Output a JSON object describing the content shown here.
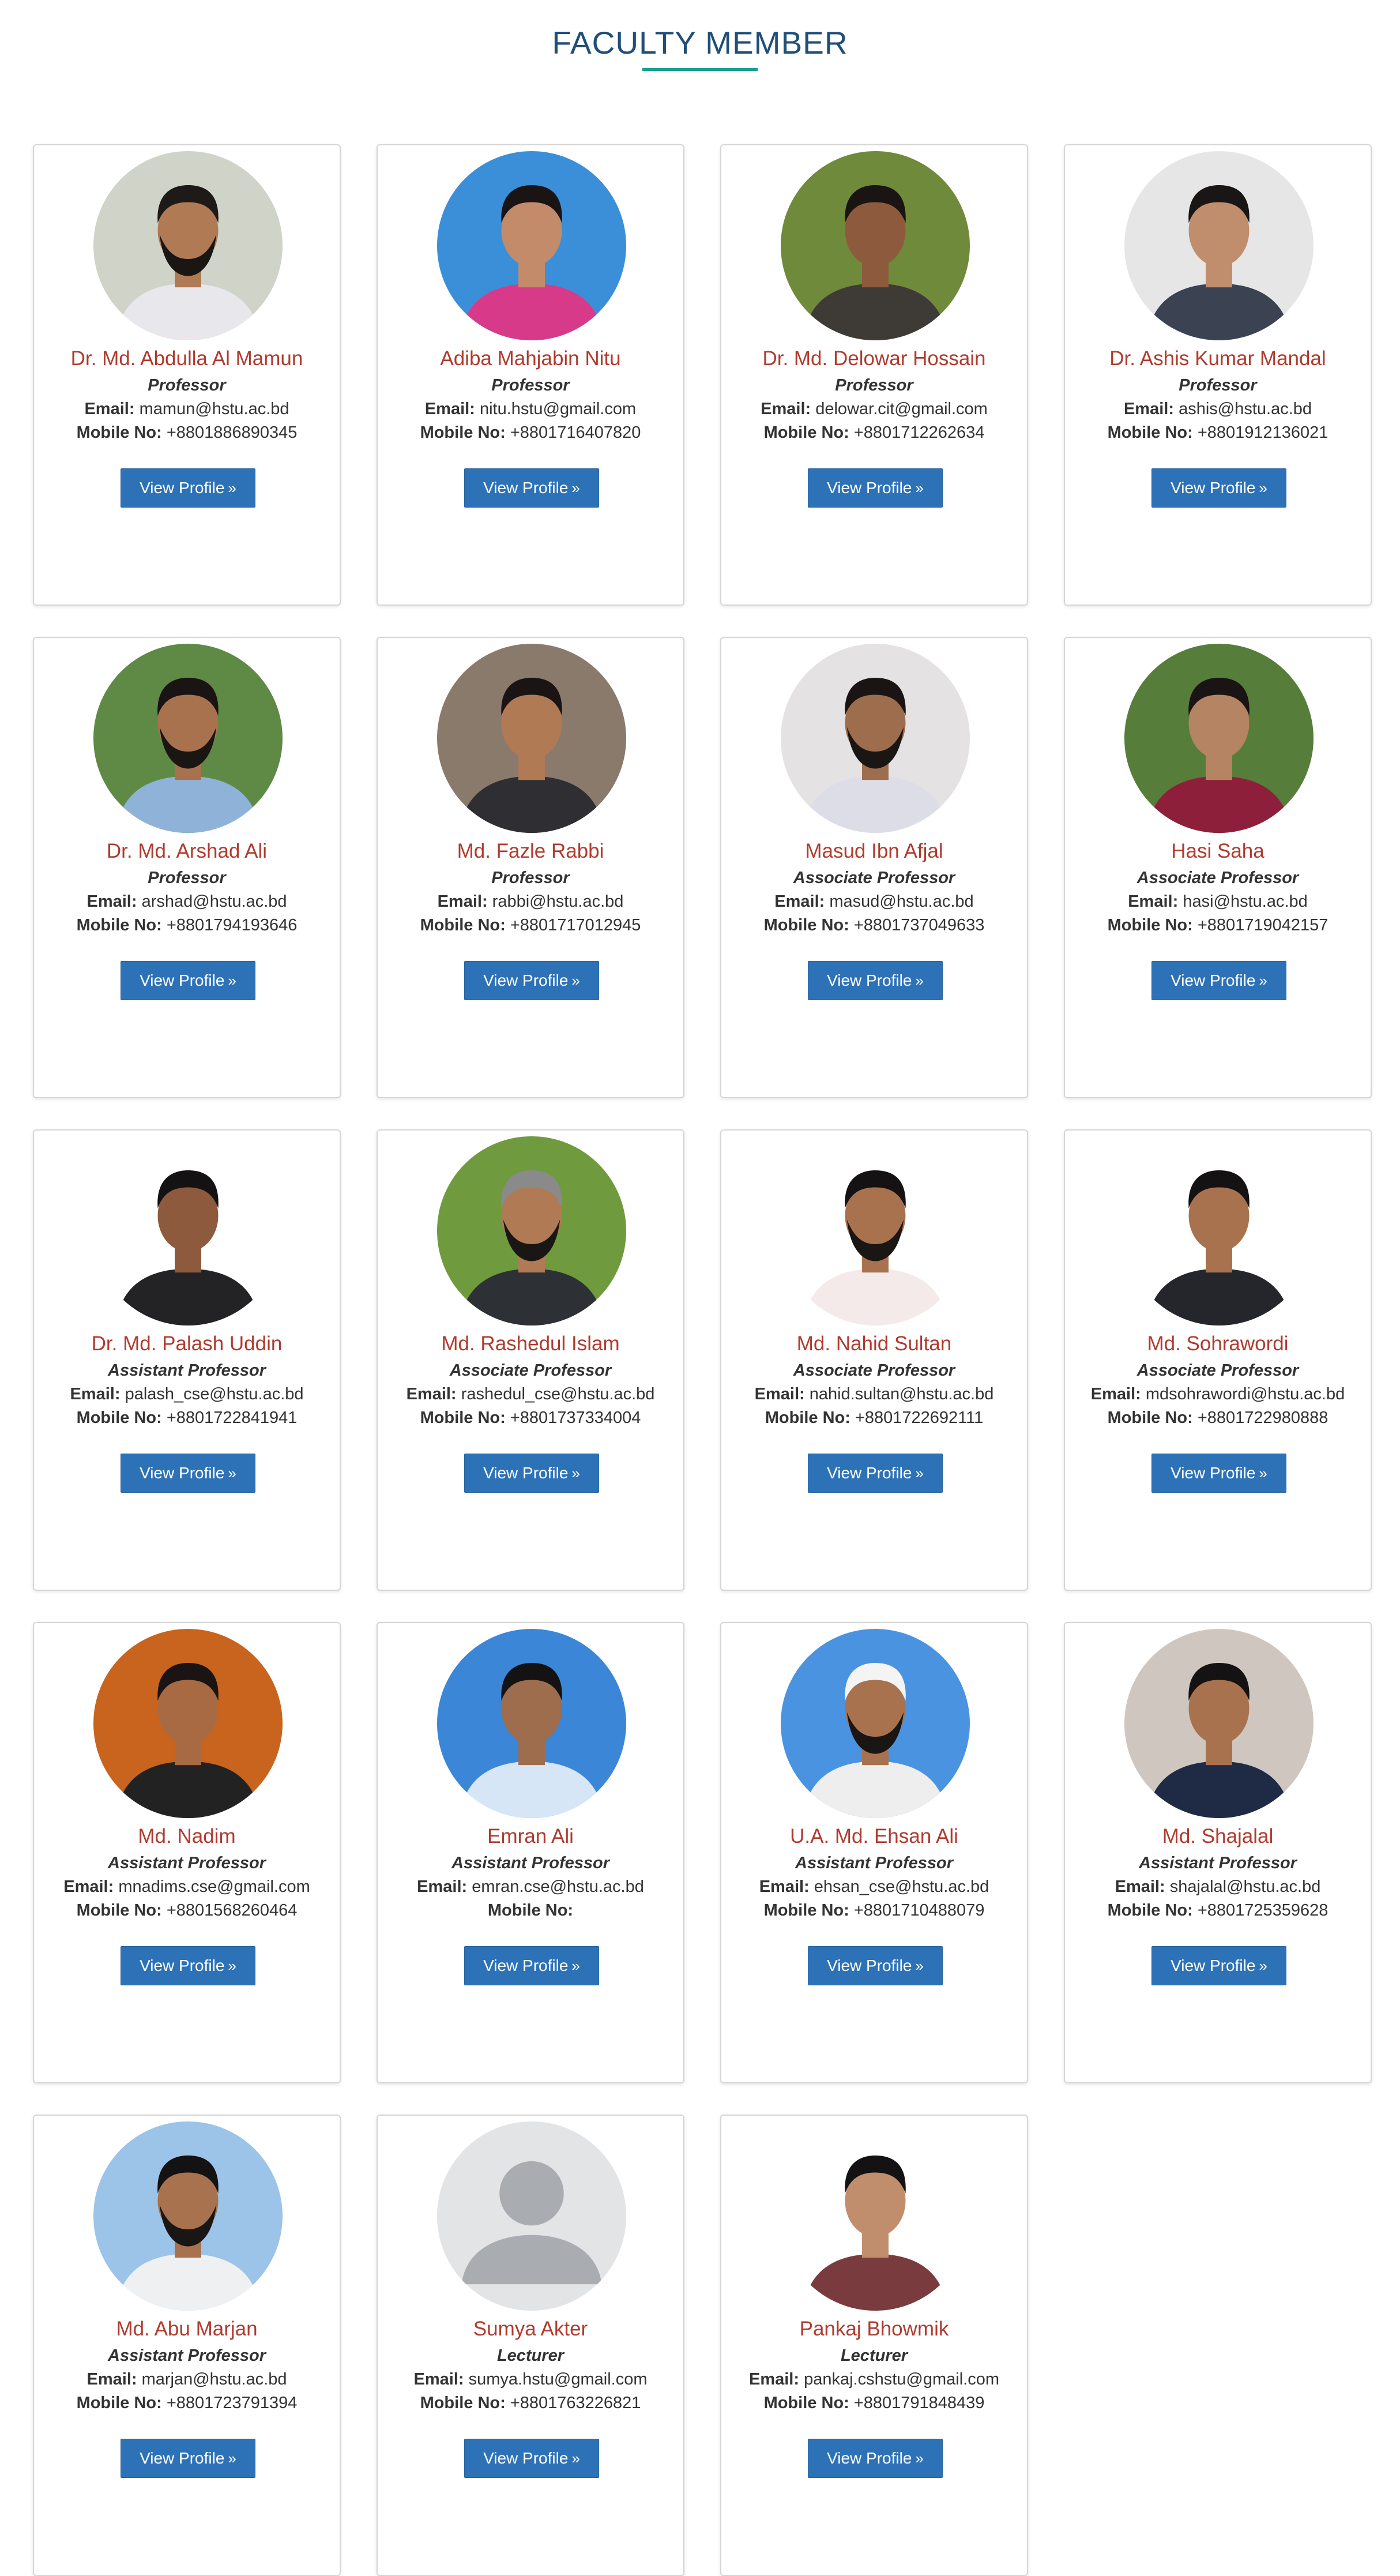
{
  "page": {
    "title": "FACULTY MEMBER"
  },
  "labels": {
    "email": "Email:",
    "mobile": "Mobile No:",
    "button": "View Profile",
    "button_icon": "»"
  },
  "members": [
    {
      "name": "Dr. Md. Abdulla Al Mamun",
      "designation": "Professor",
      "email": "mamun@hstu.ac.bd",
      "mobile": "+8801886890345",
      "photo": {
        "bg": "#cfd3c8",
        "skin": "#b07a55",
        "shirt": "#e8e8ec",
        "hair": "#1e1a18",
        "beard": true
      }
    },
    {
      "name": "Adiba Mahjabin Nitu",
      "designation": "Professor",
      "email": "nitu.hstu@gmail.com",
      "mobile": "+8801716407820",
      "photo": {
        "bg": "#3b8fd9",
        "skin": "#c48b6a",
        "shirt": "#d83a8a",
        "hair": "#1a1414",
        "beard": false
      }
    },
    {
      "name": "Dr. Md. Delowar Hossain",
      "designation": "Professor",
      "email": "delowar.cit@gmail.com",
      "mobile": "+8801712262634",
      "photo": {
        "bg": "#6f8a3a",
        "skin": "#8d5a3d",
        "shirt": "#3e3b36",
        "hair": "#1a1512",
        "beard": false
      }
    },
    {
      "name": "Dr. Ashis Kumar Mandal",
      "designation": "Professor",
      "email": "ashis@hstu.ac.bd",
      "mobile": "+8801912136021",
      "photo": {
        "bg": "#e6e6e6",
        "skin": "#c08e6c",
        "shirt": "#3b4252",
        "hair": "#1a1616",
        "beard": false
      }
    },
    {
      "name": "Dr. Md. Arshad Ali",
      "designation": "Professor",
      "email": "arshad@hstu.ac.bd",
      "mobile": "+8801794193646",
      "photo": {
        "bg": "#5f8a45",
        "skin": "#a8724f",
        "shirt": "#8fb3d8",
        "hair": "#1a1514",
        "beard": true
      }
    },
    {
      "name": "Md. Fazle Rabbi",
      "designation": "Professor",
      "email": "rabbi@hstu.ac.bd",
      "mobile": "+8801717012945",
      "photo": {
        "bg": "#8a7a6c",
        "skin": "#b07a55",
        "shirt": "#2f2f33",
        "hair": "#1a1514",
        "beard": false
      }
    },
    {
      "name": "Masud Ibn Afjal",
      "designation": "Associate Professor",
      "email": "masud@hstu.ac.bd",
      "mobile": "+8801737049633",
      "photo": {
        "bg": "#e4e2e2",
        "skin": "#9e6d4d",
        "shirt": "#dcdde6",
        "hair": "#1a1514",
        "beard": true
      }
    },
    {
      "name": "Hasi Saha",
      "designation": "Associate Professor",
      "email": "hasi@hstu.ac.bd",
      "mobile": "+8801719042157",
      "photo": {
        "bg": "#567d3a",
        "skin": "#b58462",
        "shirt": "#8e1f3a",
        "hair": "#1a1414",
        "beard": false
      }
    },
    {
      "name": "Dr. Md. Palash Uddin",
      "designation": "Assistant Professor",
      "email": "palash_cse@hstu.ac.bd",
      "mobile": "+8801722841941",
      "photo": {
        "bg": "#ffffff",
        "skin": "#8d5a3d",
        "shirt": "#232326",
        "hair": "#141212",
        "beard": false
      }
    },
    {
      "name": "Md. Rashedul Islam",
      "designation": "Associate Professor",
      "email": "rashedul_cse@hstu.ac.bd",
      "mobile": "+8801737334004",
      "photo": {
        "bg": "#6f9a3e",
        "skin": "#b07a55",
        "shirt": "#2d3136",
        "hair": "#8a8a8a",
        "beard": true
      }
    },
    {
      "name": "Md. Nahid Sultan",
      "designation": "Associate Professor",
      "email": "nahid.sultan@hstu.ac.bd",
      "mobile": "+8801722692111",
      "photo": {
        "bg": "#ffffff",
        "skin": "#a8724f",
        "shirt": "#f4eaea",
        "hair": "#141212",
        "beard": true
      }
    },
    {
      "name": "Md. Sohrawordi",
      "designation": "Associate Professor",
      "email": "mdsohrawordi@hstu.ac.bd",
      "mobile": "+8801722980888",
      "photo": {
        "bg": "#ffffff",
        "skin": "#a8724f",
        "shirt": "#25262b",
        "hair": "#141212",
        "beard": false
      }
    },
    {
      "name": "Md. Nadim",
      "designation": "Assistant Professor",
      "email": "mnadims.cse@gmail.com",
      "mobile": "+8801568260464",
      "photo": {
        "bg": "#c8641e",
        "skin": "#a86a42",
        "shirt": "#222222",
        "hair": "#1a1514",
        "beard": false
      }
    },
    {
      "name": "Emran Ali",
      "designation": "Assistant Professor",
      "email": "emran.cse@hstu.ac.bd",
      "mobile": "",
      "photo": {
        "bg": "#3b86d6",
        "skin": "#9e6d4d",
        "shirt": "#d6e6f7",
        "hair": "#141212",
        "beard": false
      }
    },
    {
      "name": "U.A. Md. Ehsan Ali",
      "designation": "Assistant Professor",
      "email": "ehsan_cse@hstu.ac.bd",
      "mobile": "+8801710488079",
      "photo": {
        "bg": "#4a93e0",
        "skin": "#a8724f",
        "shirt": "#eeeeee",
        "hair": "#f4f4f4",
        "beard": true
      }
    },
    {
      "name": "Md. Shajalal",
      "designation": "Assistant Professor",
      "email": "shajalal@hstu.ac.bd",
      "mobile": "+8801725359628",
      "photo": {
        "bg": "#cfc7bf",
        "skin": "#a8724f",
        "shirt": "#1f2a44",
        "hair": "#141212",
        "beard": false
      }
    },
    {
      "name": "Md. Abu Marjan",
      "designation": "Assistant Professor",
      "email": "marjan@hstu.ac.bd",
      "mobile": "+8801723791394",
      "photo": {
        "bg": "#9cc3e8",
        "skin": "#a8724f",
        "shirt": "#eef0f2",
        "hair": "#141212",
        "beard": true
      }
    },
    {
      "name": "Sumya Akter",
      "designation": "Lecturer",
      "email": "sumya.hstu@gmail.com",
      "mobile": "+8801763226821",
      "photo": {
        "placeholder": true,
        "bg": "#e3e4e6",
        "skin": "#a9adb2",
        "shirt": "#a9adb2",
        "hair": "#a9adb2",
        "beard": false
      }
    },
    {
      "name": "Pankaj Bhowmik",
      "designation": "Lecturer",
      "email": "pankaj.cshstu@gmail.com",
      "mobile": "+8801791848439",
      "photo": {
        "bg": "#ffffff",
        "skin": "#c08e6c",
        "shirt": "#7a3b3e",
        "hair": "#141212",
        "beard": false
      }
    }
  ]
}
